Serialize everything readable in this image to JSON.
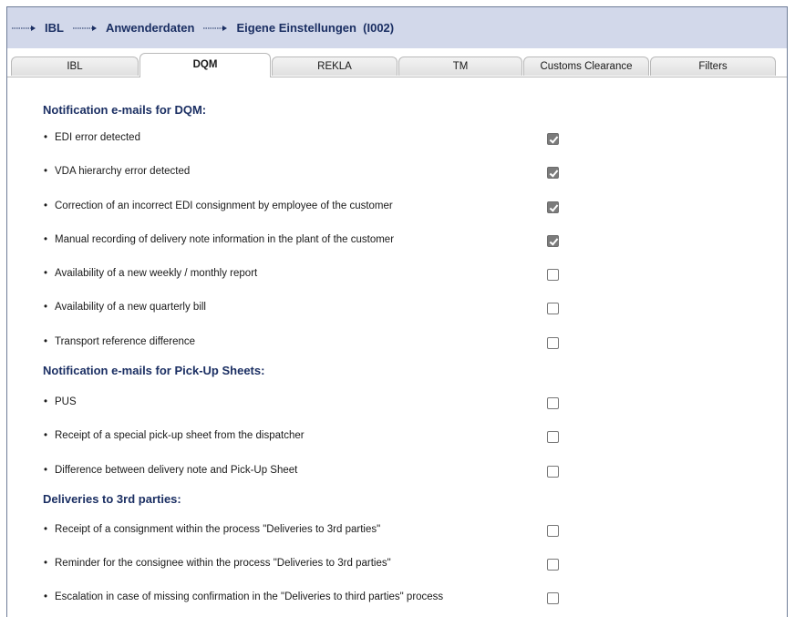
{
  "breadcrumb": {
    "items": [
      "IBL",
      "Anwenderdaten",
      "Eigene Einstellungen  (I002)"
    ]
  },
  "tabs": [
    {
      "label": "IBL",
      "active": false
    },
    {
      "label": "DQM",
      "active": true
    },
    {
      "label": "REKLA",
      "active": false
    },
    {
      "label": "TM",
      "active": false
    },
    {
      "label": "Customs Clearance",
      "active": false
    },
    {
      "label": "Filters",
      "active": false
    }
  ],
  "sections": [
    {
      "title": "Notification e-mails for DQM:",
      "items": [
        {
          "label": "EDI error detected",
          "checked": true
        },
        {
          "label": "VDA hierarchy error detected",
          "checked": true
        },
        {
          "label": "Correction of an incorrect EDI consignment by employee of the customer",
          "checked": true
        },
        {
          "label": "Manual recording of delivery note information in the plant of the customer",
          "checked": true
        },
        {
          "label": "Availability of a new weekly / monthly report",
          "checked": false
        },
        {
          "label": "Availability of a new quarterly bill",
          "checked": false
        },
        {
          "label": "Transport reference difference",
          "checked": false
        }
      ]
    },
    {
      "title": "Notification e-mails for Pick-Up Sheets:",
      "items": [
        {
          "label": "PUS",
          "checked": false
        },
        {
          "label": "Receipt of a special pick-up sheet from the dispatcher",
          "checked": false
        },
        {
          "label": "Difference between delivery note and Pick-Up Sheet",
          "checked": false
        }
      ]
    },
    {
      "title": "Deliveries to 3rd parties:",
      "items": [
        {
          "label": "Receipt of a consignment within the process \"Deliveries to 3rd parties\"",
          "checked": false
        },
        {
          "label": "Reminder for the consignee within the process \"Deliveries to 3rd parties\"",
          "checked": false
        },
        {
          "label": "Escalation in case of missing confirmation in the \"Deliveries to third parties\" process",
          "checked": false
        }
      ]
    }
  ],
  "colors": {
    "accent": "#1b2f63",
    "header_bg": "#d2d8ea",
    "checkbox_checked": "#7b7b7b"
  }
}
